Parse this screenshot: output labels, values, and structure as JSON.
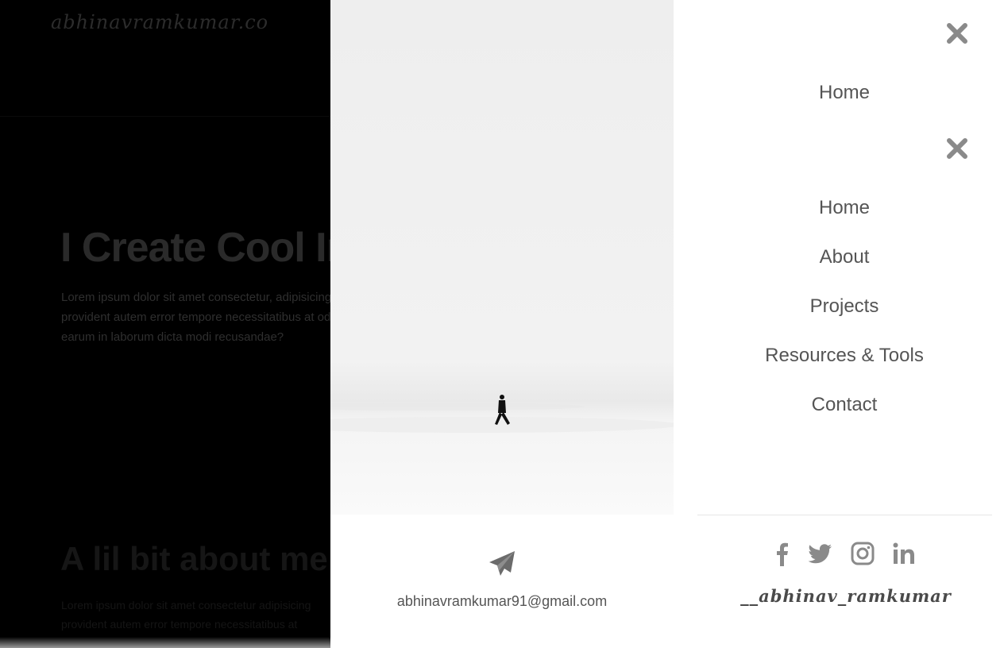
{
  "background_page": {
    "logo": "abhinavramkumar.co",
    "hero_title": "I Create Cool In",
    "hero_paragraph_lines": [
      "Lorem ipsum dolor sit amet consectetur, adipisicing",
      "provident autem error tempore necessitatibus at od",
      "earum in laborum dicta modi recusandae?"
    ],
    "about_title": "A lil bit about me",
    "about_paragraph_lines": [
      "Lorem ipsum dolor sit amet consectetur adipisicing",
      "provident autem error tempore necessitatibus at"
    ]
  },
  "contact": {
    "icon": "paper-plane-icon",
    "email": "abhinavramkumar91@gmail.com"
  },
  "menu": {
    "close_icon": "close-icon",
    "top_item": "Home",
    "items": [
      "Home",
      "About",
      "Projects",
      "Resources & Tools",
      "Contact"
    ],
    "social_icons": [
      "facebook-icon",
      "twitter-icon",
      "instagram-icon",
      "linkedin-icon"
    ],
    "signature": "__abhinav_ramkumar"
  },
  "colors": {
    "overlay_background": "#000000",
    "panel_background": "#ffffff",
    "text": "#555555",
    "icon": "#8a8a8a"
  }
}
